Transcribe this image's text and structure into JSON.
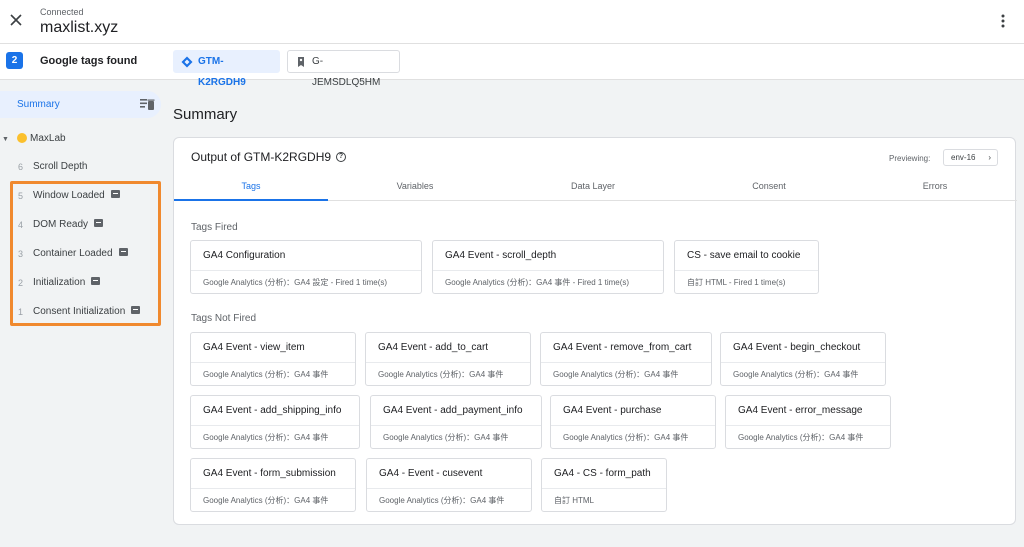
{
  "header": {
    "connected_label": "Connected",
    "site": "maxlist.xyz"
  },
  "tag_strip": {
    "count": "2",
    "found_label": "Google tags found",
    "containers": [
      {
        "id": "GTM-K2RGDH9",
        "active": true
      },
      {
        "id": "G-JEMSDLQ5HM",
        "active": false
      }
    ]
  },
  "sidebar": {
    "summary_label": "Summary",
    "group_name": "MaxLab",
    "events": [
      {
        "num": "6",
        "label": "Scroll Depth",
        "code_icon": false
      },
      {
        "num": "5",
        "label": "Window Loaded",
        "code_icon": true
      },
      {
        "num": "4",
        "label": "DOM Ready",
        "code_icon": true
      },
      {
        "num": "3",
        "label": "Container Loaded",
        "code_icon": true
      },
      {
        "num": "2",
        "label": "Initialization",
        "code_icon": true
      },
      {
        "num": "1",
        "label": "Consent Initialization",
        "code_icon": true
      }
    ],
    "highlight_color": "#f0892e"
  },
  "main": {
    "title": "Summary",
    "card_title": "Output of GTM-K2RGDH9",
    "previewing_label": "Previewing:",
    "env": "env-16",
    "tabs": [
      "Tags",
      "Variables",
      "Data Layer",
      "Consent",
      "Errors"
    ],
    "active_tab": "Tags",
    "fired_label": "Tags Fired",
    "not_fired_label": "Tags Not Fired",
    "fired": [
      {
        "name": "GA4 Configuration",
        "meta": "Google Analytics (分析)：GA4 設定 - Fired 1 time(s)"
      },
      {
        "name": "GA4 Event - scroll_depth",
        "meta": "Google Analytics (分析)：GA4 事件 - Fired 1 time(s)"
      },
      {
        "name": "CS - save email to cookie",
        "meta": "自訂 HTML - Fired 1 time(s)"
      }
    ],
    "not_fired": [
      {
        "name": "GA4 Event - view_item",
        "meta": "Google Analytics (分析)：GA4 事件"
      },
      {
        "name": "GA4 Event - add_to_cart",
        "meta": "Google Analytics (分析)：GA4 事件"
      },
      {
        "name": "GA4 Event - remove_from_cart",
        "meta": "Google Analytics (分析)：GA4 事件"
      },
      {
        "name": "GA4 Event - begin_checkout",
        "meta": "Google Analytics (分析)：GA4 事件"
      },
      {
        "name": "GA4 Event - add_shipping_info",
        "meta": "Google Analytics (分析)：GA4 事件"
      },
      {
        "name": "GA4 Event - add_payment_info",
        "meta": "Google Analytics (分析)：GA4 事件"
      },
      {
        "name": "GA4 Event - purchase",
        "meta": "Google Analytics (分析)：GA4 事件"
      },
      {
        "name": "GA4 Event - error_message",
        "meta": "Google Analytics (分析)：GA4 事件"
      },
      {
        "name": "GA4 Event - form_submission",
        "meta": "Google Analytics (分析)：GA4 事件"
      },
      {
        "name": "GA4 - Event - cusevent",
        "meta": "Google Analytics (分析)：GA4 事件"
      },
      {
        "name": "GA4 - CS - form_path",
        "meta": "自訂 HTML"
      }
    ]
  },
  "colors": {
    "accent": "#1a73e8",
    "background": "#f1f3f4"
  }
}
